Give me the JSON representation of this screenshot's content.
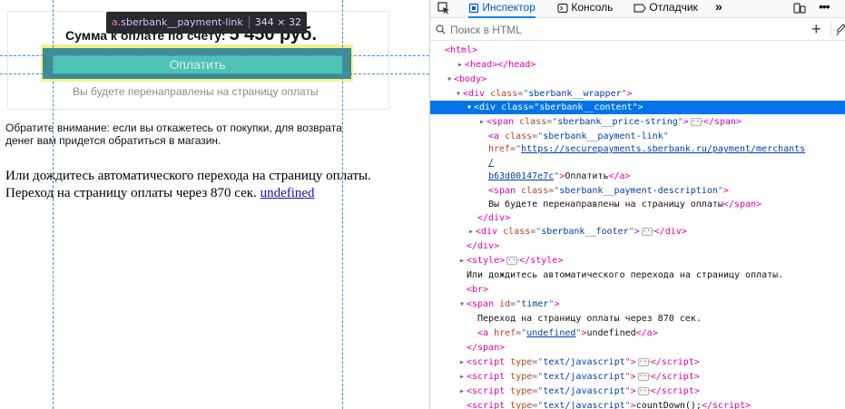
{
  "page": {
    "price_prefix": "Сумма к оплате по счету:",
    "price_amount": "5 450 руб.",
    "pay_button_label": "Оплатить",
    "pay_description": "Вы будете перенаправлены на страницу оплаты",
    "notice": "Обратите внимание: если вы откажетесь от покупки, для возврата денег вам придется обратиться в магазин.",
    "auto_redirect": "Или дождитесь автоматического перехода на страницу оплаты.",
    "timer_text": "Переход на страницу оплаты через 870 сек.",
    "timer_link": "undefined"
  },
  "tooltip": {
    "tag": "a",
    "class": ".sberbank__payment-link",
    "size": "344 × 32"
  },
  "devtools": {
    "tabs": [
      "Инспектор",
      "Консоль",
      "Отладчик"
    ],
    "active_tab": "Инспектор",
    "search_placeholder": "Поиск в HTML",
    "accent_color": "#0074e8",
    "tree": {
      "html": "<html>",
      "head": "<head></head>",
      "body": "<body>",
      "wrapper_class": "sberbank__wrapper",
      "content_class": "sberbank__content",
      "price_class": "sberbank__price-string",
      "link_class": "sberbank__payment-link",
      "link_href": "https://securepayments.sberbank.ru/payment/merchants",
      "link_href_cont": "b63d00147e7c",
      "link_text": "Оплатить",
      "desc_class": "sberbank__payment-description",
      "desc_text": "Вы будете перенаправлены на страницу оплаты",
      "footer_class": "sberbank__footer",
      "style": "style",
      "text_node": "Или дождитесь автоматического перехода на страницу оплаты.",
      "br": "<br>",
      "span_id": "timer",
      "timer_text": "Переход на страницу оплаты через 870 сек.",
      "timer_href": "undefined",
      "timer_link_text": "undefined",
      "script_type": "text/javascript",
      "script_tail": "countDown();"
    }
  }
}
